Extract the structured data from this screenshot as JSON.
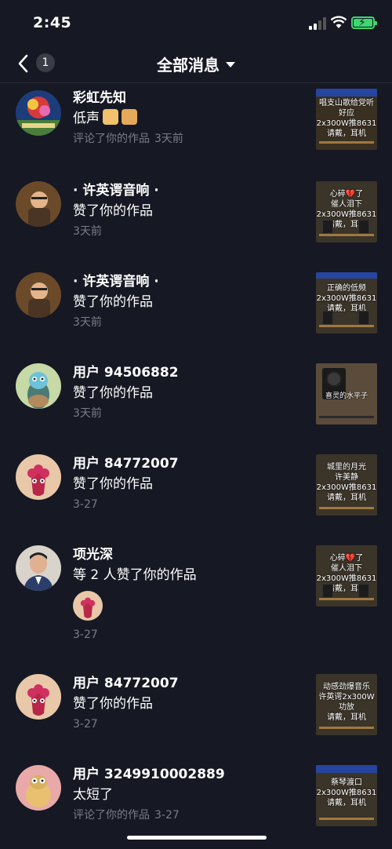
{
  "status": {
    "time": "2:45"
  },
  "nav": {
    "unread_count": "1",
    "title": "全部消息"
  },
  "items": [
    {
      "name": "彩虹先知",
      "content": "低声",
      "action": "评论了你的作品",
      "time": "3天前",
      "avatar": "flower-photo",
      "thumb_text": "唱支山歌给党听\n好应\n2x300W推8631\n请戴，耳机"
    },
    {
      "name": "· 许英谔音响 ·",
      "content": "赞了你的作品",
      "action": "",
      "time": "3天前",
      "avatar": "man-photo",
      "thumb_text": "心碎💔了\n催人泪下\n2x300W推8631\n请戴，耳机"
    },
    {
      "name": "· 许英谔音响 ·",
      "content": "赞了你的作品",
      "action": "",
      "time": "3天前",
      "avatar": "man-photo",
      "thumb_text": "正确的低频\n2x300W推8631\n请戴，耳机"
    },
    {
      "name": "用户 94506882",
      "content": "赞了你的作品",
      "action": "",
      "time": "3天前",
      "avatar": "default-green",
      "thumb_text": "喜灵的水平子"
    },
    {
      "name": "用户 84772007",
      "content": "赞了你的作品",
      "action": "",
      "time": "3-27",
      "avatar": "default-pink",
      "thumb_text": "城里的月光\n许美静\n2x300W推8631\n请戴，耳机"
    },
    {
      "name": "项光深",
      "content": "等 2 人赞了你的作品",
      "action": "",
      "time": "3-27",
      "avatar": "man-portrait",
      "thumb_text": "心碎💔了\n催人泪下\n2x300W推8631\n请戴，耳机"
    },
    {
      "name": "用户 84772007",
      "content": "赞了你的作品",
      "action": "",
      "time": "3-27",
      "avatar": "default-pink",
      "thumb_text": "动感劲爆音乐\n许英谔2x300W\n功放\n请戴，耳机"
    },
    {
      "name": "用户 3249910002889",
      "content": "太短了",
      "action": "评论了你的作品",
      "time": "3-27",
      "avatar": "default-yellow",
      "thumb_text": "蔡琴渡口\n2x300W推8631\n请戴，耳机"
    }
  ]
}
